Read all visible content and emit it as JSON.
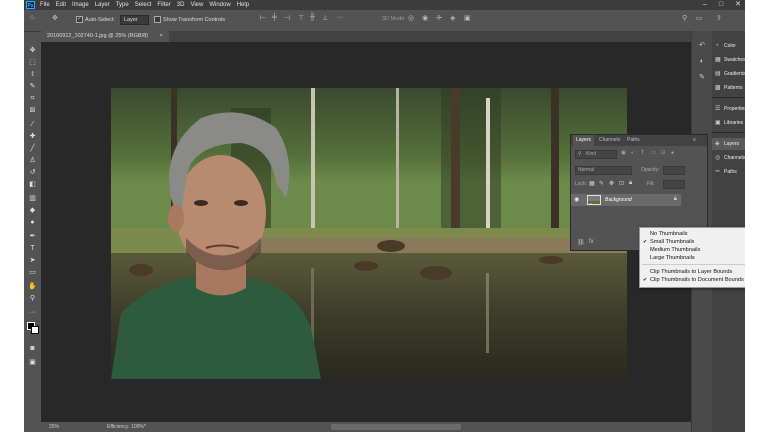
{
  "app": {
    "logo": "Ps"
  },
  "menu": [
    "File",
    "Edit",
    "Image",
    "Layer",
    "Type",
    "Select",
    "Filter",
    "3D",
    "View",
    "Window",
    "Help"
  ],
  "window_controls": [
    "–",
    "□",
    "✕"
  ],
  "options": {
    "auto_select_label": "Auto-Select:",
    "auto_select_value": "Layer",
    "show_transform_label": "Show Transform Controls",
    "mode_label": "3D Mode:"
  },
  "document": {
    "tab_title": "20160912_102740-1.jpg @ 25% (RGB/8)",
    "close": "×"
  },
  "status": {
    "zoom": "25%",
    "efficiency": "Efficiency: 100%*"
  },
  "panels": {
    "color": "Color",
    "swatches": "Swatches",
    "gradients": "Gradients",
    "patterns": "Patterns",
    "properties": "Properties",
    "libraries": "Libraries",
    "layers": "Layers",
    "channels": "Channels",
    "paths": "Paths"
  },
  "layers_panel": {
    "tabs": [
      "Layers",
      "Channels",
      "Paths"
    ],
    "kind_label": "Kind",
    "blend_mode": "Normal",
    "opacity_label": "Opacity:",
    "lock_label": "Lock:",
    "fill_label": "Fill:",
    "layer_name": "Background",
    "footer_link": "fx"
  },
  "thumbnail_menu": {
    "items": [
      "No Thumbnails",
      "Small Thumbnails",
      "Medium Thumbnails",
      "Large Thumbnails"
    ],
    "items2": [
      "Clip Thumbnails to Layer Bounds",
      "Clip Thumbnails to Document Bounds"
    ],
    "checked": [
      "Small Thumbnails",
      "Clip Thumbnails to Document Bounds"
    ],
    "checkmark": "✔"
  },
  "colors": {
    "ui_bg": "#535353",
    "canvas_bg": "#282828",
    "accent": "#31a8ff"
  }
}
